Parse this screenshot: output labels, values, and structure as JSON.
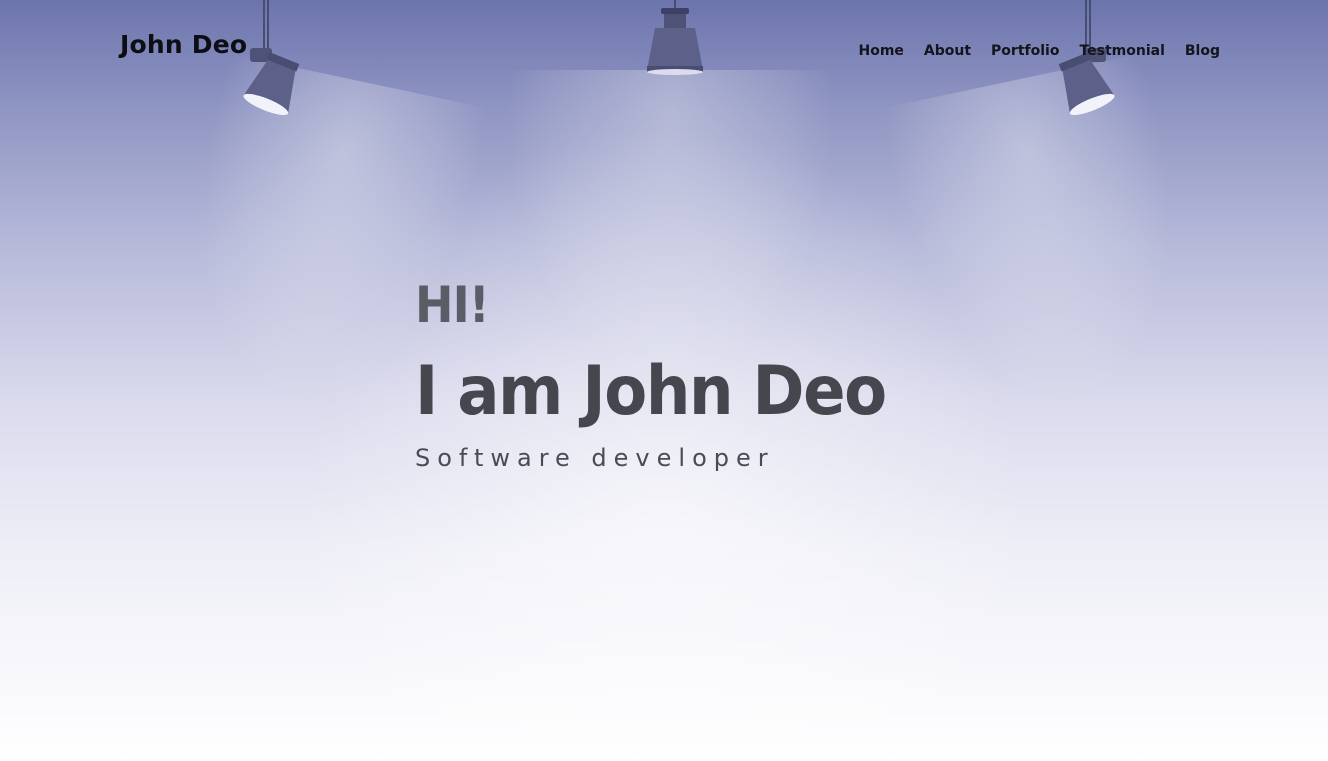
{
  "header": {
    "brand": "John Deo",
    "nav": [
      {
        "label": "Home"
      },
      {
        "label": "About"
      },
      {
        "label": "Portfolio"
      },
      {
        "label": "Testmonial"
      },
      {
        "label": "Blog"
      }
    ]
  },
  "hero": {
    "greeting": "HI!",
    "headline": "I am John Deo",
    "role": "Software developer"
  },
  "decor": {
    "icons": [
      "spotlight-icon",
      "pendant-lamp-icon",
      "spotlight-icon"
    ]
  },
  "colors": {
    "background_top": "#6c74ad",
    "background_bottom": "#ffffff",
    "lamp_body": "#5d6088",
    "headline": "#45464e",
    "greeting": "#5b5d66"
  }
}
